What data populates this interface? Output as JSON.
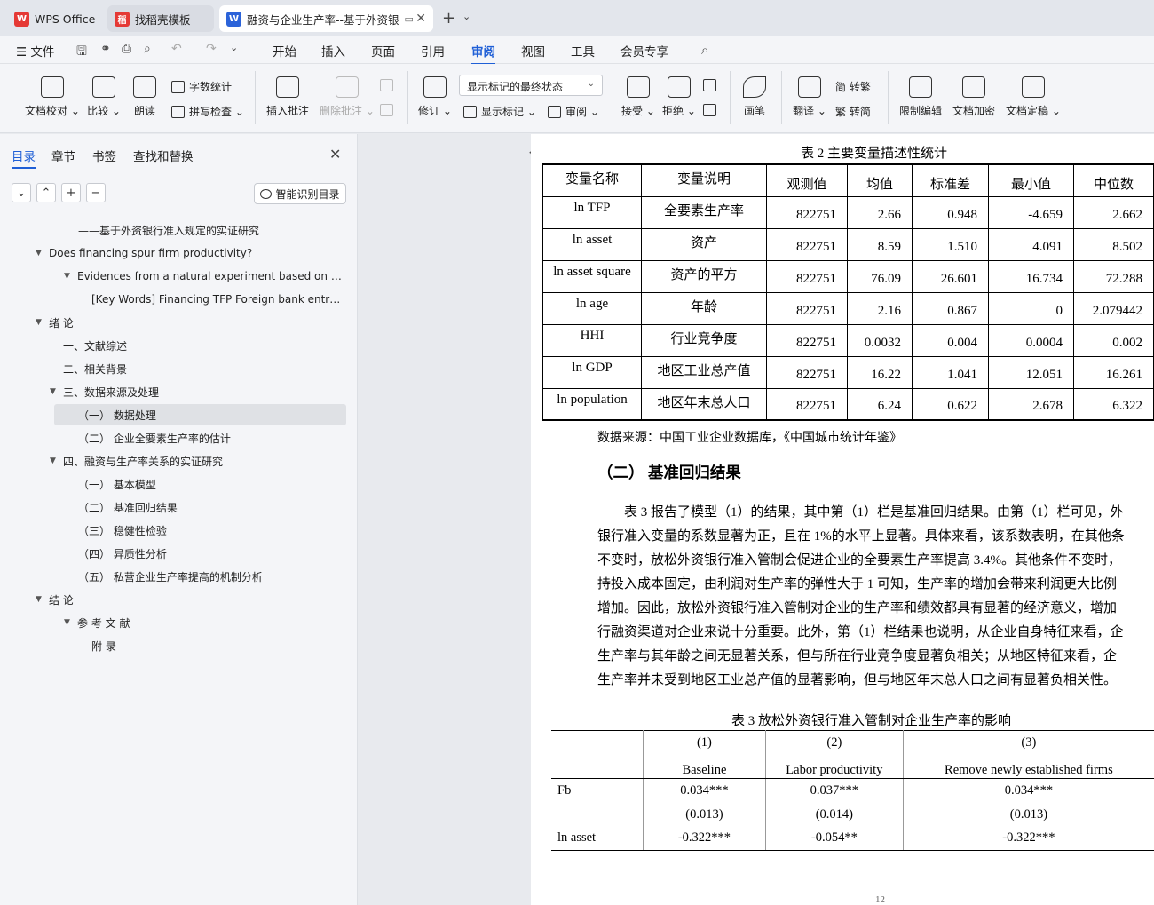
{
  "tabs": [
    {
      "label": "WPS Office",
      "icon": "wps-logo"
    },
    {
      "label": "找稻壳模板",
      "icon": "docer-logo"
    },
    {
      "label": "融资与企业生产率--基于外资银",
      "icon": "word-doc-icon"
    }
  ],
  "menu": {
    "file": "文件",
    "items": [
      "开始",
      "插入",
      "页面",
      "引用",
      "审阅",
      "视图",
      "工具",
      "会员专享"
    ],
    "active": "审阅"
  },
  "ribbon": {
    "doc_check": "文档校对",
    "compare": "比较",
    "read_aloud": "朗读",
    "word_count": "字数统计",
    "spell_check": "拼写检查",
    "insert_comment": "插入批注",
    "delete_comment": "删除批注",
    "track": "修订",
    "show_markup": "显示标记",
    "review": "审阅",
    "markup_state": "显示标记的最终状态",
    "accept": "接受",
    "reject": "拒绝",
    "ink": "画笔",
    "translate": "翻译",
    "to_trad": "简 转繁",
    "to_simp": "繁 转简",
    "restrict_edit": "限制编辑",
    "encrypt": "文档加密",
    "finalize": "文档定稿"
  },
  "sidebar": {
    "tabs": [
      "目录",
      "章节",
      "书签",
      "查找和替换"
    ],
    "smart_btn": "智能识别目录",
    "toc": [
      {
        "label": "——基于外资银行准入规定的实证研究",
        "indent": 88,
        "arrow": false
      },
      {
        "label": "Does financing spur firm productivity?",
        "indent": 55,
        "arrow": true
      },
      {
        "label": "Evidences from a natural experiment based on fo ...",
        "indent": 87,
        "arrow": true
      },
      {
        "label": "[Key Words] Financing TFP Foreign bank entry ...",
        "indent": 103,
        "arrow": false
      },
      {
        "label": "绪   论",
        "indent": 55,
        "arrow": true
      },
      {
        "label": "一、文献综述",
        "indent": 71,
        "arrow": false
      },
      {
        "label": "二、相关背景",
        "indent": 71,
        "arrow": false
      },
      {
        "label": "三、数据来源及处理",
        "indent": 71,
        "arrow": true
      },
      {
        "label": "（一）  数据处理",
        "indent": 88,
        "arrow": false,
        "selected": true
      },
      {
        "label": "（二）  企业全要素生产率的估计",
        "indent": 88,
        "arrow": false
      },
      {
        "label": "四、融资与生产率关系的实证研究",
        "indent": 71,
        "arrow": true
      },
      {
        "label": "（一）  基本模型",
        "indent": 88,
        "arrow": false
      },
      {
        "label": "（二）  基准回归结果",
        "indent": 88,
        "arrow": false
      },
      {
        "label": "（三）  稳健性检验",
        "indent": 88,
        "arrow": false
      },
      {
        "label": "（四）  异质性分析",
        "indent": 88,
        "arrow": false
      },
      {
        "label": "（五）  私营企业生产率提高的机制分析",
        "indent": 88,
        "arrow": false
      },
      {
        "label": "结 论",
        "indent": 55,
        "arrow": true
      },
      {
        "label": "参 考 文 献",
        "indent": 87,
        "arrow": true
      },
      {
        "label": "附 录",
        "indent": 103,
        "arrow": false
      }
    ]
  },
  "document": {
    "table2": {
      "caption": "表  2  主要变量描述性统计",
      "headers": [
        "变量名称",
        "变量说明",
        "观测值",
        "均值",
        "标准差",
        "最小值",
        "中位数"
      ],
      "rows": [
        [
          "ln TFP",
          "全要素生产率",
          "822751",
          "2.66",
          "0.948",
          "-4.659",
          "2.662"
        ],
        [
          "ln asset",
          "资产",
          "822751",
          "8.59",
          "1.510",
          "4.091",
          "8.502"
        ],
        [
          "ln asset square",
          "资产的平方",
          "822751",
          "76.09",
          "26.601",
          "16.734",
          "72.288"
        ],
        [
          "ln age",
          "年龄",
          "822751",
          "2.16",
          "0.867",
          "0",
          "2.079442"
        ],
        [
          "HHI",
          "行业竞争度",
          "822751",
          "0.0032",
          "0.004",
          "0.0004",
          "0.002"
        ],
        [
          "ln GDP",
          "地区工业总产值",
          "822751",
          "16.22",
          "1.041",
          "12.051",
          "16.261"
        ],
        [
          "ln population",
          "地区年末总人口",
          "822751",
          "6.24",
          "0.622",
          "2.678",
          "6.322"
        ]
      ]
    },
    "source_note": "数据来源：中国工业企业数据库，《中国城市统计年鉴》",
    "section_heading": "（二）  基准回归结果",
    "paragraph": [
      "表 3 报告了模型（1）的结果，其中第（1）栏是基准回归结果。由第（1）栏可见，外",
      "银行准入变量的系数显著为正，且在  1%的水平上显著。具体来看，该系数表明，在其他条",
      "不变时，放松外资银行准入管制会促进企业的全要素生产率提高  3.4%。其他条件不变时，",
      "持投入成本固定，由利润对生产率的弹性大于  1 可知，生产率的增加会带来利润更大比例",
      "增加。因此，放松外资银行准入管制对企业的生产率和绩效都具有显著的经济意义，增加",
      "行融资渠道对企业来说十分重要。此外，第（1）栏结果也说明，从企业自身特征来看，企",
      "生产率与其年龄之间无显著关系，但与所在行业竞争度显著负相关；从地区特征来看，企",
      "生产率并未受到地区工业总产值的显著影响，但与地区年末总人口之间有显著负相关性。"
    ],
    "table3": {
      "caption": "表  3 放松外资银行准入管制对企业生产率的影响",
      "col_numbers": [
        "(1)",
        "(2)",
        "(3)"
      ],
      "col_labels": [
        "Baseline",
        "Labor productivity",
        "Remove newly established firms"
      ],
      "rows": [
        [
          "Fb",
          "0.034***",
          "0.037***",
          "0.034***"
        ],
        [
          "",
          "(0.013)",
          "(0.014)",
          "(0.013)"
        ],
        [
          "ln asset",
          "-0.322***",
          "-0.054**",
          "-0.322***"
        ]
      ]
    },
    "page_number": "12"
  }
}
